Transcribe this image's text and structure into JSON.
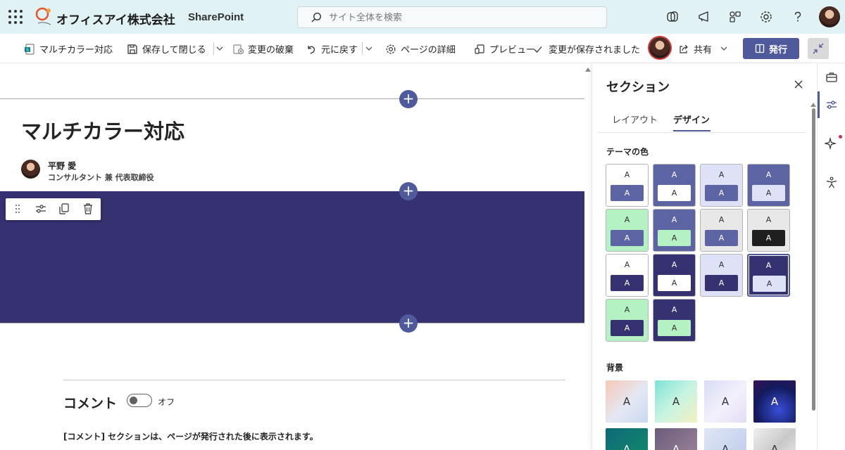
{
  "suite": {
    "company": "オフィスアイ株式会社",
    "app_name": "SharePoint",
    "search_placeholder": "サイト全体を検索"
  },
  "commands": {
    "page_name": "マルチカラー対応",
    "save_close": "保存して閉じる",
    "discard": "変更の破棄",
    "undo": "元に戻す",
    "page_details": "ページの詳細",
    "preview": "プレビュー",
    "saved_status": "変更が保存されました",
    "share": "共有",
    "publish": "発行"
  },
  "page": {
    "title": "マルチカラー対応",
    "author_name": "平野 愛",
    "author_role": "コンサルタント 兼 代表取締役",
    "section_color": "#363171"
  },
  "comments": {
    "title": "コメント",
    "toggle_state": "オフ",
    "note": "[コメント] セクションは、ページが発行された後に表示されます。"
  },
  "panel": {
    "title": "セクション",
    "tabs": [
      "レイアウト",
      "デザイン"
    ],
    "active_tab": "デザイン",
    "theme_label": "テーマの色",
    "background_label": "背景",
    "theme_glyph": "A",
    "selected_theme_index": 11,
    "themes": [
      {
        "top_bg": "#ffffff",
        "top_fg": "#333333",
        "chip_bg": "#5c64a3",
        "chip_fg": "#ffffff"
      },
      {
        "top_bg": "#5c64a3",
        "top_fg": "#ffffff",
        "chip_bg": "#ffffff",
        "chip_fg": "#333333"
      },
      {
        "top_bg": "#dfe2f7",
        "top_fg": "#333333",
        "chip_bg": "#5c64a3",
        "chip_fg": "#ffffff"
      },
      {
        "top_bg": "#5c64a3",
        "top_fg": "#ffffff",
        "chip_bg": "#dfe2f7",
        "chip_fg": "#333333"
      },
      {
        "top_bg": "#b4f2c4",
        "top_fg": "#333333",
        "chip_bg": "#5c64a3",
        "chip_fg": "#ffffff"
      },
      {
        "top_bg": "#5c64a3",
        "top_fg": "#ffffff",
        "chip_bg": "#b4f2c4",
        "chip_fg": "#333333"
      },
      {
        "top_bg": "#e8e8e8",
        "top_fg": "#333333",
        "chip_bg": "#5c64a3",
        "chip_fg": "#ffffff"
      },
      {
        "top_bg": "#e8e8e8",
        "top_fg": "#333333",
        "chip_bg": "#1f1f1f",
        "chip_fg": "#ffffff"
      },
      {
        "top_bg": "#ffffff",
        "top_fg": "#333333",
        "chip_bg": "#363171",
        "chip_fg": "#ffffff"
      },
      {
        "top_bg": "#363171",
        "top_fg": "#ffffff",
        "chip_bg": "#ffffff",
        "chip_fg": "#333333"
      },
      {
        "top_bg": "#dfe2f7",
        "top_fg": "#333333",
        "chip_bg": "#363171",
        "chip_fg": "#ffffff"
      },
      {
        "top_bg": "#363171",
        "top_fg": "#ffffff",
        "chip_bg": "#dfe2f7",
        "chip_fg": "#333333"
      },
      {
        "top_bg": "#b4f2c4",
        "top_fg": "#333333",
        "chip_bg": "#363171",
        "chip_fg": "#ffffff"
      },
      {
        "top_bg": "#363171",
        "top_fg": "#ffffff",
        "chip_bg": "#b4f2c4",
        "chip_fg": "#333333"
      }
    ],
    "backgrounds": [
      {
        "gradient": "linear-gradient(135deg, #f7c8b6, #e4e8f5 55%, #c9d8ee)",
        "fg": "#333333"
      },
      {
        "gradient": "linear-gradient(135deg, #7fe3d6, #c7f4e2 50%, #f3f0c2)",
        "fg": "#333333"
      },
      {
        "gradient": "linear-gradient(135deg, #d9dcf7, #f3f1fb 55%, #e3dcf6)",
        "fg": "#333333"
      },
      {
        "gradient": "radial-gradient(circle at 60% 70%, #3a4ed8, #121a5c 60%, #3a1254)",
        "fg": "#ffffff"
      },
      {
        "gradient": "linear-gradient(135deg, #0e6a78, #138e6a)",
        "fg": "#ffffff"
      },
      {
        "gradient": "linear-gradient(135deg, #6a5a7a, #a48da0)",
        "fg": "#ffffff"
      },
      {
        "gradient": "linear-gradient(135deg, #dfe6f5, #b9c9ea)",
        "fg": "#333333"
      },
      {
        "gradient": "linear-gradient(135deg, #f0f0f0, #c8c8c8 50%, #f4f4f4)",
        "fg": "#333333"
      }
    ]
  },
  "colors": {
    "accent": "#4f5a9c",
    "suite_bg": "#e0f2f4",
    "section_band": "#363171"
  },
  "icons": [
    "waffle-icon",
    "search-icon",
    "teams-icon",
    "megaphone-icon",
    "share-hub-icon",
    "settings-icon",
    "help-icon",
    "sharepoint-page-icon",
    "save-icon",
    "discard-icon",
    "undo-icon",
    "gear-icon",
    "preview-icon",
    "check-icon",
    "share-icon",
    "publish-icon",
    "collapse-icon",
    "drag-icon",
    "edit-section-icon",
    "duplicate-icon",
    "delete-icon",
    "close-icon",
    "briefcase-icon",
    "sliders-icon",
    "sparkle-icon",
    "accessibility-icon"
  ]
}
